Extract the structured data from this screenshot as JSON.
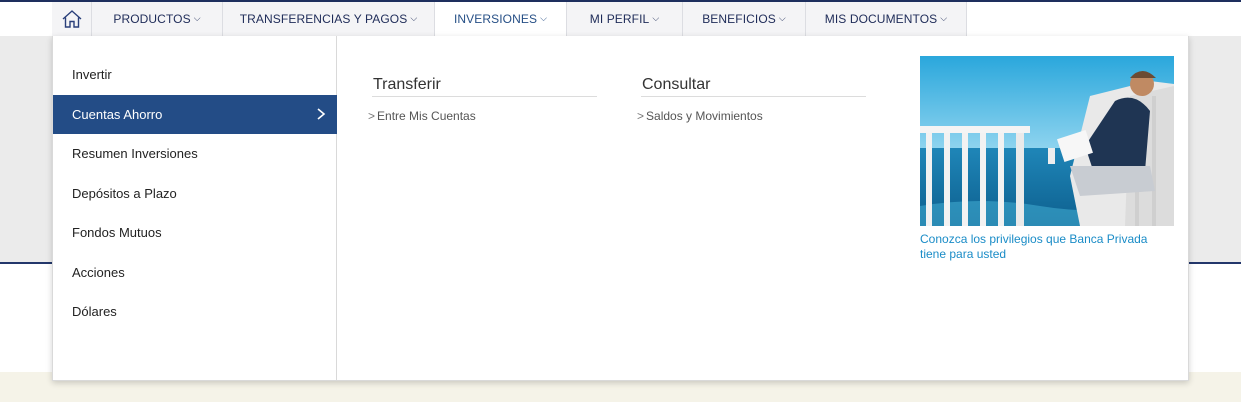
{
  "nav": {
    "home_icon": "home-icon",
    "items": [
      {
        "label": "PRODUCTOS",
        "chevron": "⌵"
      },
      {
        "label": "TRANSFERENCIAS Y PAGOS",
        "chevron": "⌵"
      },
      {
        "label": "INVERSIONES",
        "chevron": "⌵"
      },
      {
        "label": "MI PERFIL",
        "chevron": "⌵"
      },
      {
        "label": "BENEFICIOS",
        "chevron": "⌵"
      },
      {
        "label": "MIS DOCUMENTOS",
        "chevron": "⌵"
      }
    ],
    "active_index": 2
  },
  "sidebar": {
    "items": [
      {
        "label": "Invertir"
      },
      {
        "label": "Cuentas Ahorro"
      },
      {
        "label": "Resumen Inversiones"
      },
      {
        "label": "Depósitos a Plazo"
      },
      {
        "label": "Fondos Mutuos"
      },
      {
        "label": "Acciones"
      },
      {
        "label": "Dólares"
      }
    ],
    "selected_index": 1
  },
  "columns": [
    {
      "title": "Transferir",
      "links": [
        {
          "label": "Entre Mis Cuentas"
        }
      ]
    },
    {
      "title": "Consultar",
      "links": [
        {
          "label": "Saldos y Movimientos"
        }
      ]
    }
  ],
  "link_prefix": ">",
  "promo": {
    "caption": "Conozca los privilegios que Banca Privada tiene para usted"
  },
  "colors": {
    "brand_navy": "#1e2b58",
    "selected_bg": "#234c86",
    "link_blue": "#1a8cc7"
  }
}
